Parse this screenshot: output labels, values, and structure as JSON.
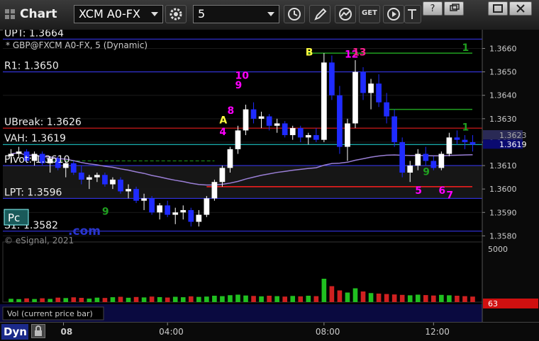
{
  "window": {
    "title": "Chart",
    "symbol": "XCM A0-FX",
    "interval": "5",
    "get_label": "GET",
    "help_label": "?"
  },
  "chart_info": {
    "study_label": "* GBP@FXCM A0-FX, 5 (Dynamic)",
    "copyright": "© eSignal, 2021",
    "watermark": ".com",
    "pc_label": "Pc",
    "volume_label": "Vol (current price bar)",
    "dyn_label": "Dyn"
  },
  "colors": {
    "background": "#000000",
    "candle_up": "#ffffff",
    "candle_down": "#1f2bff",
    "vwap": "#9a7fd6",
    "ma": "#9a7fd6",
    "level_blue": "#3a3aff",
    "level_red": "#ff2020",
    "level_cyan": "#20e0e0",
    "level_green": "#20a020",
    "magenta": "#ff00ff",
    "yellow": "#ffff40"
  },
  "chart_data": {
    "type": "candlestick",
    "ylim": [
      1.3578,
      1.3668
    ],
    "y_ticks": [
      "1.3660",
      "1.3650",
      "1.3640",
      "1.3630",
      "1.3620",
      "1.3610",
      "1.3600",
      "1.3590",
      "1.3580"
    ],
    "x_ticks": [
      "08",
      "04:00",
      "08:00",
      "12:00"
    ],
    "last_price": "1.3619",
    "upper_price": "1.3623",
    "levels": [
      {
        "label": "UPT: 1.3664",
        "value": 1.3664,
        "color": "#3a3aff"
      },
      {
        "label": "R1: 1.3650",
        "value": 1.365,
        "color": "#3a3aff"
      },
      {
        "label": "UBreak: 1.3626",
        "value": 1.3626,
        "color": "#ff2020"
      },
      {
        "label": "VAH: 1.3619",
        "value": 1.3619,
        "color": "#20e0e0"
      },
      {
        "label": "Pivot: 1.3610",
        "value": 1.361,
        "color": "#3a3aff"
      },
      {
        "label": "LPT: 1.3596",
        "value": 1.3596,
        "color": "#3a3aff"
      },
      {
        "label": "S1: 1.3582",
        "value": 1.3582,
        "color": "#3a3aff"
      }
    ],
    "candles": [
      [
        1.3614,
        1.3617,
        1.3611,
        1.3615
      ],
      [
        1.3615,
        1.3618,
        1.3613,
        1.3616
      ],
      [
        1.3616,
        1.3617,
        1.3611,
        1.3612
      ],
      [
        1.3612,
        1.3616,
        1.361,
        1.3615
      ],
      [
        1.3615,
        1.3616,
        1.361,
        1.3611
      ],
      [
        1.3611,
        1.3614,
        1.3607,
        1.3613
      ],
      [
        1.3613,
        1.3614,
        1.3608,
        1.3609
      ],
      [
        1.3609,
        1.3612,
        1.3605,
        1.3611
      ],
      [
        1.3611,
        1.3612,
        1.3606,
        1.3607
      ],
      [
        1.3607,
        1.361,
        1.3602,
        1.3604
      ],
      [
        1.3604,
        1.3606,
        1.36,
        1.3605
      ],
      [
        1.3605,
        1.3607,
        1.3603,
        1.3606
      ],
      [
        1.3606,
        1.3607,
        1.3601,
        1.3602
      ],
      [
        1.3602,
        1.3605,
        1.36,
        1.3604
      ],
      [
        1.3604,
        1.3605,
        1.3598,
        1.3599
      ],
      [
        1.3599,
        1.3602,
        1.3596,
        1.36
      ],
      [
        1.36,
        1.3601,
        1.3594,
        1.3595
      ],
      [
        1.3595,
        1.3598,
        1.3591,
        1.3596
      ],
      [
        1.3596,
        1.3597,
        1.3589,
        1.359
      ],
      [
        1.359,
        1.3594,
        1.3587,
        1.3593
      ],
      [
        1.3593,
        1.3595,
        1.3588,
        1.3589
      ],
      [
        1.3589,
        1.3592,
        1.3585,
        1.359
      ],
      [
        1.359,
        1.3593,
        1.3587,
        1.3591
      ],
      [
        1.3591,
        1.3592,
        1.3584,
        1.3586
      ],
      [
        1.3586,
        1.3591,
        1.3584,
        1.3589
      ],
      [
        1.3589,
        1.3597,
        1.3588,
        1.3596
      ],
      [
        1.3596,
        1.3604,
        1.3595,
        1.3603
      ],
      [
        1.3603,
        1.361,
        1.3601,
        1.3609
      ],
      [
        1.3609,
        1.3618,
        1.3607,
        1.3617
      ],
      [
        1.3617,
        1.3627,
        1.3615,
        1.3625
      ],
      [
        1.3625,
        1.3636,
        1.3623,
        1.3634
      ],
      [
        1.3634,
        1.3637,
        1.3628,
        1.363
      ],
      [
        1.363,
        1.3633,
        1.3626,
        1.3631
      ],
      [
        1.3631,
        1.3632,
        1.3625,
        1.3627
      ],
      [
        1.3627,
        1.363,
        1.3624,
        1.3628
      ],
      [
        1.3628,
        1.3629,
        1.3622,
        1.3623
      ],
      [
        1.3623,
        1.3627,
        1.3621,
        1.3626
      ],
      [
        1.3626,
        1.3627,
        1.362,
        1.3622
      ],
      [
        1.3622,
        1.3624,
        1.3619,
        1.3623
      ],
      [
        1.3623,
        1.3626,
        1.362,
        1.3621
      ],
      [
        1.3621,
        1.3658,
        1.362,
        1.3654
      ],
      [
        1.3654,
        1.3657,
        1.3638,
        1.364
      ],
      [
        1.364,
        1.3644,
        1.3615,
        1.3618
      ],
      [
        1.3618,
        1.363,
        1.3612,
        1.3628
      ],
      [
        1.3628,
        1.3655,
        1.3626,
        1.365
      ],
      [
        1.365,
        1.3652,
        1.3638,
        1.3641
      ],
      [
        1.3641,
        1.3647,
        1.3634,
        1.3645
      ],
      [
        1.3645,
        1.3649,
        1.3635,
        1.3637
      ],
      [
        1.3637,
        1.3641,
        1.3628,
        1.3631
      ],
      [
        1.3631,
        1.3634,
        1.3618,
        1.362
      ],
      [
        1.362,
        1.3622,
        1.3605,
        1.3607
      ],
      [
        1.3607,
        1.3612,
        1.3603,
        1.361
      ],
      [
        1.361,
        1.3617,
        1.3608,
        1.3615
      ],
      [
        1.3615,
        1.3618,
        1.361,
        1.3612
      ],
      [
        1.3612,
        1.3614,
        1.3608,
        1.3609
      ],
      [
        1.3609,
        1.3616,
        1.3608,
        1.3615
      ],
      [
        1.3615,
        1.3624,
        1.3614,
        1.3622
      ],
      [
        1.3622,
        1.3625,
        1.3619,
        1.3621
      ],
      [
        1.3621,
        1.3623,
        1.3617,
        1.362
      ],
      [
        1.362,
        1.3623,
        1.3616,
        1.3619
      ]
    ],
    "volume": {
      "y_ticks": [
        "5000"
      ],
      "last_value": "63",
      "values": [
        310,
        280,
        350,
        290,
        360,
        300,
        420,
        380,
        450,
        400,
        330,
        420,
        390,
        460,
        500,
        410,
        480,
        440,
        520,
        470,
        430,
        500,
        460,
        540,
        490,
        520,
        600,
        560,
        650,
        700,
        620,
        580,
        540,
        600,
        560,
        520,
        580,
        540,
        600,
        560,
        2200,
        1500,
        1100,
        900,
        1300,
        1000,
        850,
        800,
        760,
        720,
        680,
        640,
        700,
        660,
        620,
        680,
        640,
        600,
        560,
        520
      ]
    },
    "annotations": [
      {
        "text": "10",
        "color": "#ff00ff",
        "x": 1.3647,
        "idx": 29
      },
      {
        "text": "9",
        "color": "#ff00ff",
        "x": 1.3643,
        "idx": 29
      },
      {
        "text": "8",
        "color": "#ff00ff",
        "x": 1.3632,
        "idx": 28
      },
      {
        "text": "A",
        "color": "#ffff40",
        "x": 1.3628,
        "idx": 27
      },
      {
        "text": "4",
        "color": "#ff00ff",
        "x": 1.3623,
        "idx": 27
      },
      {
        "text": "B",
        "color": "#ffff40",
        "x": 1.3657,
        "idx": 38
      },
      {
        "text": "12",
        "color": "#ff00ff",
        "x": 1.3656,
        "idx": 43
      },
      {
        "text": "13",
        "color": "#ff2090",
        "x": 1.3657,
        "idx": 44
      },
      {
        "text": "1",
        "color": "#20a020",
        "x": 1.3659,
        "idx": 58
      },
      {
        "text": "1",
        "color": "#20a020",
        "x": 1.3625,
        "idx": 58
      },
      {
        "text": "5",
        "color": "#ff00ff",
        "x": 1.3598,
        "idx": 52
      },
      {
        "text": "6",
        "color": "#ff00ff",
        "x": 1.3598,
        "idx": 55
      },
      {
        "text": "7",
        "color": "#ff00ff",
        "x": 1.3596,
        "idx": 56
      },
      {
        "text": "9",
        "color": "#20a020",
        "x": 1.3606,
        "idx": 53
      },
      {
        "text": "9",
        "color": "#20a020",
        "x": 1.3589,
        "idx": 12
      }
    ]
  }
}
